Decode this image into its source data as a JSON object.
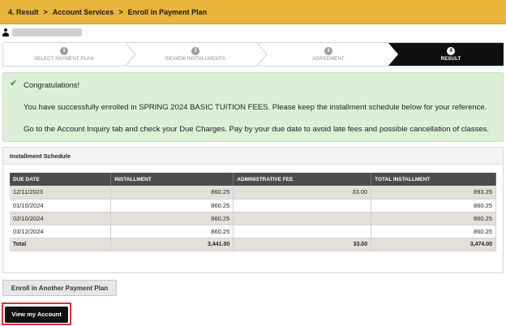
{
  "breadcrumb": {
    "items": [
      "4. Result",
      "Account Services",
      "Enroll in Payment Plan"
    ],
    "separator": ">"
  },
  "user": {
    "icon": "user-icon"
  },
  "steps": [
    {
      "num": "1",
      "label": "SELECT PAYMENT PLAN"
    },
    {
      "num": "2",
      "label": "REVIEW INSTALLMENTS"
    },
    {
      "num": "3",
      "label": "AGREEMENT"
    },
    {
      "num": "4",
      "label": "RESULT"
    }
  ],
  "alert": {
    "icon": "check-icon",
    "title": "Congratulations!",
    "line1": "You have successfully enrolled in SPRING 2024 BASIC TUITION FEES.  Please keep the installment schedule below for your reference.",
    "line2": "Go to the Account Inquiry tab and check your Due Charges. Pay by your due date to avoid late fees and possible cancellation of classes.",
    "color": "#dcf0d7"
  },
  "schedule": {
    "title": "Installment Schedule",
    "headers": [
      "DUE DATE",
      "INSTALLMENT",
      "ADMINISTRATIVE FEE",
      "TOTAL INSTALLMENT"
    ],
    "rows": [
      [
        "12/11/2023",
        "860.25",
        "33.00",
        "893.25"
      ],
      [
        "01/10/2024",
        "860.25",
        "",
        "860.25"
      ],
      [
        "02/10/2024",
        "860.25",
        "",
        "860.25"
      ],
      [
        "03/12/2024",
        "860.25",
        "",
        "860.25"
      ]
    ],
    "total": [
      "Total",
      "3,441.00",
      "33.00",
      "3,474.00"
    ]
  },
  "buttons": {
    "enroll_another": "Enroll in Another Payment Plan",
    "view_account": "View my Account"
  },
  "colors": {
    "breadcrumb_bg": "#e8b53a",
    "active_step_bg": "#0f0f0f",
    "table_header_bg": "#4d4d4d",
    "highlight_border": "#d9323c"
  }
}
